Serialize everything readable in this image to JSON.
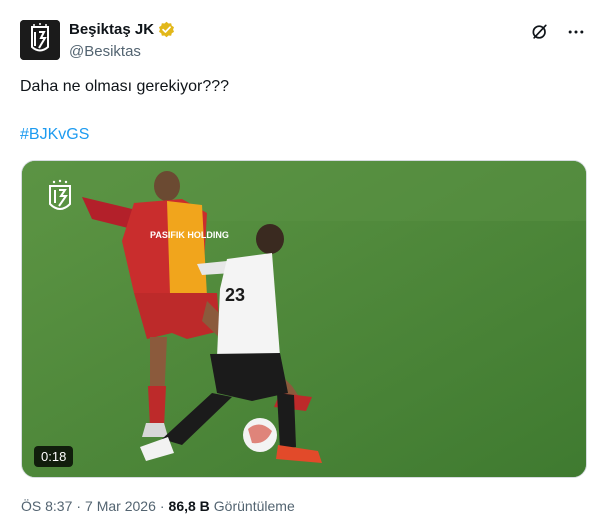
{
  "author": {
    "display_name": "Beşiktaş JK",
    "handle": "@Besiktas",
    "verified_badge": "gold-verified-icon",
    "avatar": "besiktas-crest-logo"
  },
  "tweet": {
    "text": "Daha ne olması gerekiyor???",
    "hashtag": "#BJKvGS"
  },
  "media": {
    "duration": "0:18",
    "watermark": "besiktas-crest-logo",
    "player_left_sponsor": "PASIFIK HOLDING"
  },
  "meta": {
    "time": "ÖS 8:37",
    "separator": "·",
    "date": "7 Mar 2026",
    "separator2": "·",
    "views_count": "86,8 B",
    "views_label": "Görüntüleme"
  },
  "colors": {
    "link": "#1d9bf0",
    "secondary_text": "#536471",
    "verified_gold": "#e2b719",
    "pitch": "#4f8a3a"
  },
  "icons": {
    "grok": "grok-icon",
    "more": "more-options-icon"
  }
}
